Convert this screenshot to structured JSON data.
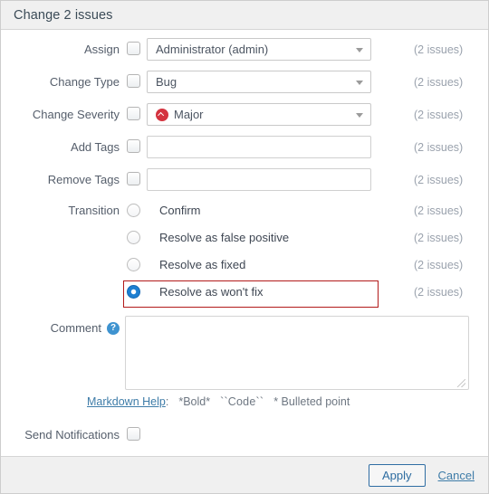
{
  "dialog": {
    "title": "Change 2 issues"
  },
  "rows": [
    {
      "label": "Assign",
      "control": "select",
      "value": "Administrator (admin)",
      "note": "(2 issues)"
    },
    {
      "label": "Change Type",
      "control": "select",
      "value": "Bug",
      "note": "(2 issues)"
    },
    {
      "label": "Change Severity",
      "control": "select",
      "value": "Major",
      "icon": "severity-major-icon",
      "icon_color": "#d4333f",
      "note": "(2 issues)"
    },
    {
      "label": "Add Tags",
      "control": "text",
      "value": "",
      "placeholder": "",
      "note": "(2 issues)"
    },
    {
      "label": "Remove Tags",
      "control": "text",
      "value": "",
      "placeholder": "",
      "note": "(2 issues)"
    }
  ],
  "transition": {
    "label": "Transition",
    "options": [
      {
        "label": "Confirm",
        "selected": false,
        "note": "(2 issues)"
      },
      {
        "label": "Resolve as false positive",
        "selected": false,
        "note": "(2 issues)"
      },
      {
        "label": "Resolve as fixed",
        "selected": false,
        "note": "(2 issues)"
      },
      {
        "label": "Resolve as won't fix",
        "selected": true,
        "note": "(2 issues)",
        "highlighted": true
      }
    ],
    "highlight_color": "#b21a1a"
  },
  "comment": {
    "label": "Comment",
    "help_icon": "question-mark-icon",
    "value": "",
    "placeholder": "",
    "markdown": {
      "link": "Markdown Help",
      "separator": ":",
      "bold": "*Bold*",
      "code": "``Code``",
      "bullet": "* Bulleted point"
    }
  },
  "notifications": {
    "label": "Send Notifications",
    "checked": false
  },
  "footer": {
    "apply": "Apply",
    "cancel": "Cancel",
    "accent": "#2f6da3"
  }
}
